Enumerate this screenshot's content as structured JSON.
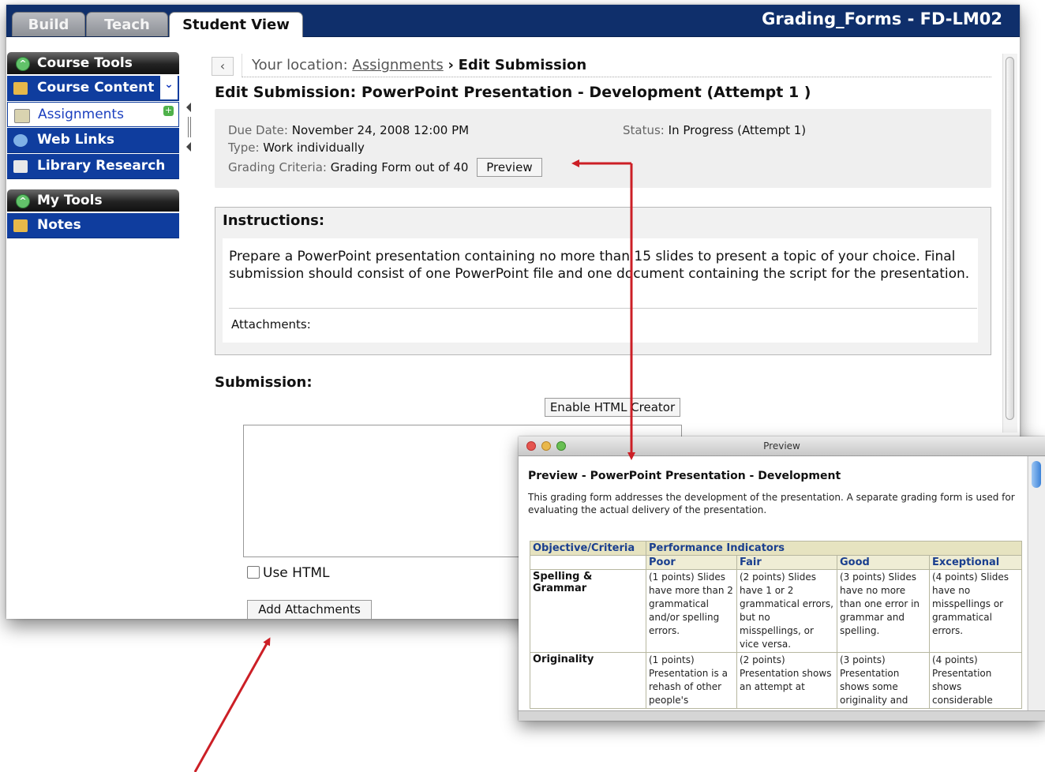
{
  "tabs": [
    {
      "label": "Build"
    },
    {
      "label": "Teach"
    },
    {
      "label": "Student View"
    }
  ],
  "course_title": "Grading_Forms - FD-LM02",
  "nav": {
    "course_tools": "Course Tools",
    "items": [
      {
        "label": "Course Content",
        "icon": "home-icon"
      },
      {
        "label": "Assignments",
        "icon": "pencil-icon"
      },
      {
        "label": "Web Links",
        "icon": "globe-icon"
      },
      {
        "label": "Library Research",
        "icon": "book-icon"
      }
    ],
    "my_tools": "My Tools",
    "my_items": [
      {
        "label": "Notes",
        "icon": "note-icon"
      }
    ]
  },
  "breadcrumb": {
    "prefix": "Your location:",
    "link": "Assignments",
    "sep": "›",
    "current": "Edit Submission"
  },
  "page_title": "Edit Submission: PowerPoint Presentation - Development (Attempt 1 )",
  "meta": {
    "due_label": "Due Date:",
    "due_value": "November 24, 2008 12:00 PM",
    "status_label": "Status:",
    "status_value": "In Progress (Attempt 1)",
    "type_label": "Type:",
    "type_value": "Work individually",
    "criteria_label": "Grading Criteria:",
    "criteria_value": "Grading Form out of 40",
    "preview_button": "Preview"
  },
  "instructions": {
    "heading": "Instructions:",
    "text": "Prepare a PowerPoint presentation containing no more than 15 slides to present a topic of your choice. Final submission should consist of one PowerPoint file and one document containing the script for the presentation.",
    "attachments": "Attachments:"
  },
  "submission": {
    "heading": "Submission:",
    "enable_html": "Enable HTML Creator",
    "use_html": "Use HTML",
    "add_attachments": "Add Attachments"
  },
  "preview_window": {
    "title": "Preview",
    "heading": "Preview - PowerPoint Presentation - Development",
    "description": "This grading form addresses the development of the presentation. A separate grading form is used for evaluating the actual delivery of the presentation.",
    "col_criteria": "Objective/Criteria",
    "col_indicators": "Performance Indicators",
    "levels": [
      "Poor",
      "Fair",
      "Good",
      "Exceptional"
    ],
    "rows": [
      {
        "criteria": "Spelling & Grammar",
        "cells": [
          "(1 points) Slides have more than 2 grammatical and/or spelling errors.",
          "(2 points) Slides have 1 or 2 grammatical errors, but no misspellings, or vice versa.",
          "(3 points) Slides have no more than one error in grammar and spelling.",
          "(4 points) Slides have no misspellings or grammatical errors."
        ]
      },
      {
        "criteria": "Originality",
        "cells": [
          "(1 points) Presentation is a rehash of other people's",
          "(2 points) Presentation shows an attempt at",
          "(3 points) Presentation shows some originality and",
          "(4 points) Presentation shows considerable"
        ]
      }
    ]
  },
  "colors": {
    "navy": "#0f2f6b",
    "nav_blue": "#0f3d9e",
    "arrow_red": "#cc1f26",
    "rubric_header": "#e6e3c0"
  }
}
